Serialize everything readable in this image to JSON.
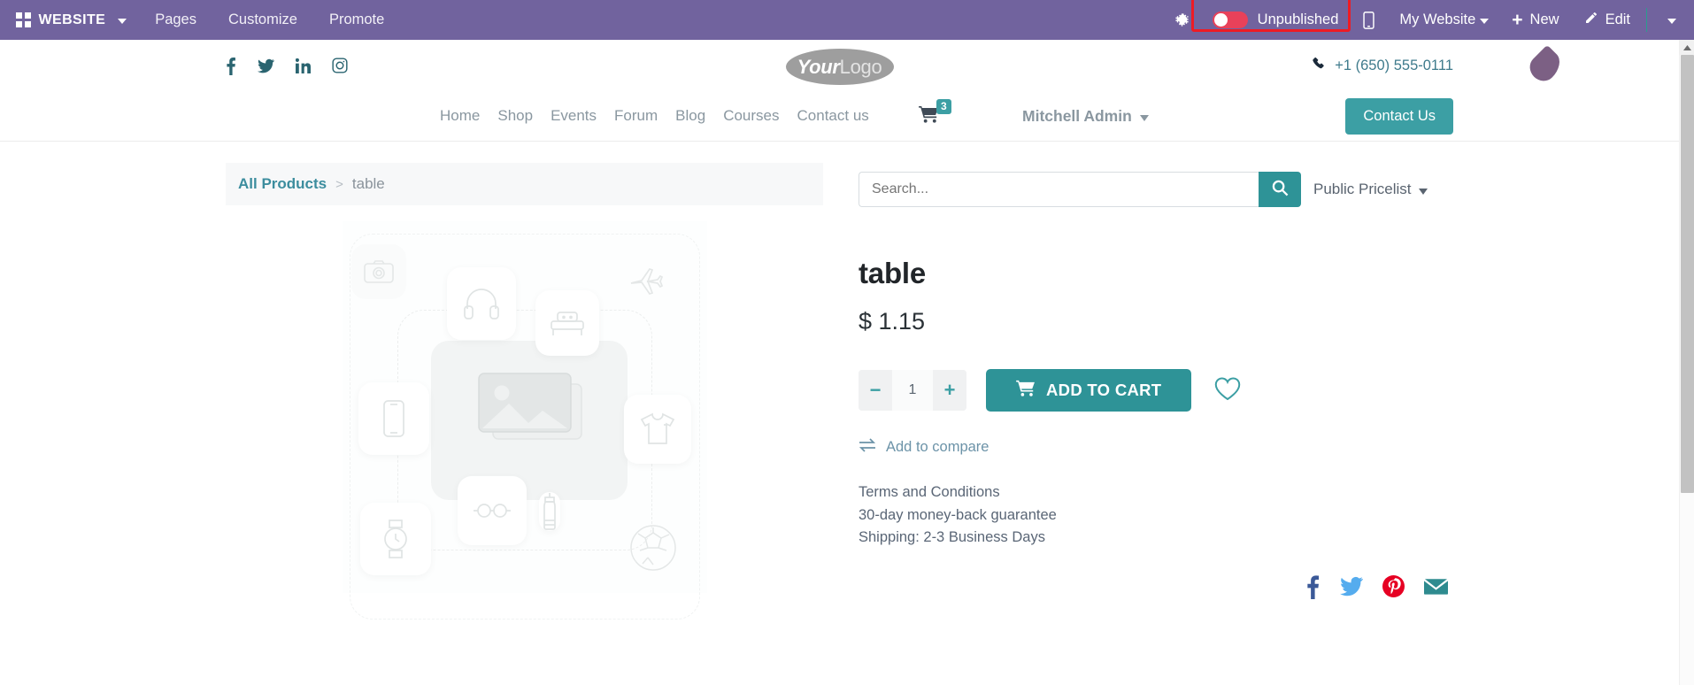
{
  "editor_bar": {
    "apps_icon": "apps-grid-icon",
    "apps_label": "WEBSITE",
    "menu_items": [
      {
        "label": "Pages",
        "name": "pages"
      },
      {
        "label": "Customize",
        "name": "customize"
      },
      {
        "label": "Promote",
        "name": "promote"
      }
    ],
    "debug_icon": "bug-icon",
    "publish": {
      "label": "Unpublished",
      "state": "off",
      "toggle_color": "#e8415a",
      "highlight_color": "#ee1b24"
    },
    "mobile_preview_icon": "mobile-phone-icon",
    "website_selector": "My Website",
    "new_label": "New",
    "new_icon": "plus-icon",
    "edit_label": "Edit",
    "edit_icon": "pencil-icon",
    "overflow_icon": "chevron-down-icon",
    "bar_color": "#71639e"
  },
  "site_header": {
    "socials": [
      {
        "name": "facebook",
        "glyph": "f"
      },
      {
        "name": "twitter",
        "glyph": "t"
      },
      {
        "name": "linkedin",
        "glyph": "in"
      },
      {
        "name": "instagram",
        "glyph": "ig"
      }
    ],
    "logo": {
      "bold_text": "Your",
      "light_text": "Logo"
    },
    "phone": "+1 (650) 555-0111",
    "phone_icon": "phone-icon"
  },
  "site_nav": {
    "links": [
      {
        "label": "Home"
      },
      {
        "label": "Shop"
      },
      {
        "label": "Events"
      },
      {
        "label": "Forum"
      },
      {
        "label": "Blog"
      },
      {
        "label": "Courses"
      },
      {
        "label": "Contact us"
      }
    ],
    "cart": {
      "icon": "shopping-cart-icon",
      "count": "3",
      "badge_color": "#3c9fa4"
    },
    "user": "Mitchell Admin",
    "cta_button": "Contact Us",
    "accent_color": "#3c9fa4"
  },
  "breadcrumb": {
    "root": "All Products",
    "separator": ">",
    "current": "table"
  },
  "search": {
    "placeholder": "Search...",
    "value": "",
    "button_icon": "search-icon",
    "pricelist_label": "Public Pricelist"
  },
  "product": {
    "name": "table",
    "price": "$ 1.15",
    "quantity": "1",
    "decrease_label": "−",
    "increase_label": "+",
    "add_to_cart_label": "ADD TO CART",
    "add_to_cart_icon": "cart-plus-icon",
    "wishlist_icon": "heart-outline-icon",
    "compare_label": "Add to compare",
    "compare_icon": "exchange-arrows-icon",
    "terms": [
      "Terms and Conditions",
      "30-day money-back guarantee",
      "Shipping: 2-3 Business Days"
    ],
    "share": [
      {
        "name": "facebook",
        "color": "#3b5998"
      },
      {
        "name": "twitter",
        "color": "#55acee"
      },
      {
        "name": "pinterest",
        "color": "#e60023"
      },
      {
        "name": "email",
        "color": "#2e8b8f"
      }
    ],
    "placeholder_image": {
      "alt": "product image placeholder",
      "icons": [
        "camera",
        "headphones",
        "bed",
        "airplane",
        "smartphone",
        "image",
        "t-shirt",
        "glasses",
        "watch",
        "bottle",
        "soccer-ball"
      ]
    }
  },
  "scrollbar": {
    "up_icon": "scroll-up-arrow-icon"
  }
}
